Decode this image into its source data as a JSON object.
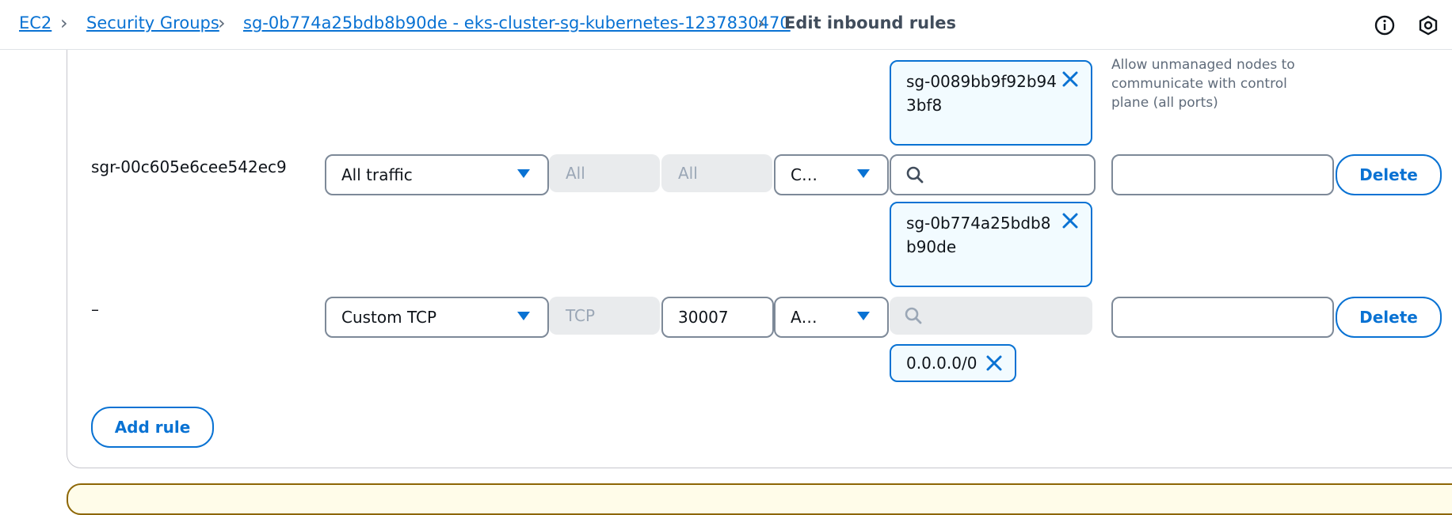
{
  "breadcrumb": {
    "items": [
      "EC2",
      "Security Groups",
      "sg-0b774a25bdb8b90de - eks-cluster-sg-kubernetes-1237830470"
    ],
    "current": "Edit inbound rules"
  },
  "header_icons": [
    "info-icon",
    "settings-hexagon-icon"
  ],
  "rules": [
    {
      "id": "sgr-00c605e6cee542ec9",
      "type": "All traffic",
      "protocol": "All",
      "port_range": "All",
      "source_type": "C…",
      "source_token": "sg-0b774a25bdb8b90de",
      "description": "",
      "delete_label": "Delete"
    },
    {
      "id": "–",
      "type": "Custom TCP",
      "protocol": "TCP",
      "port_range": "30007",
      "source_type": "A…",
      "source_token": "0.0.0.0/0",
      "description": "",
      "delete_label": "Delete"
    }
  ],
  "prev_rule": {
    "source_token": "sg-0089bb9f92b943bf8",
    "description": "Allow unmanaged nodes to communicate with control plane (all ports)"
  },
  "add_rule_label": "Add rule",
  "colors": {
    "accent": "#0972d3",
    "token_bg": "#f2fbff",
    "disabled_bg": "#e9ebed"
  }
}
